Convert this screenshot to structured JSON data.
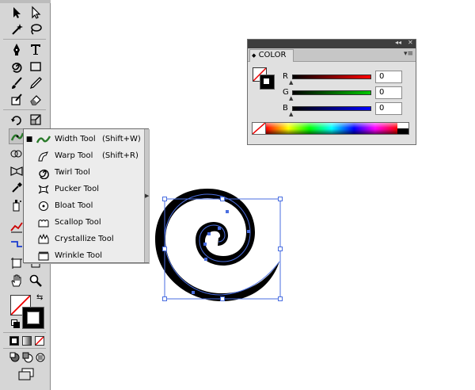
{
  "flyout": {
    "items": [
      {
        "label": "Width Tool",
        "shortcut": "(Shift+W)",
        "selected": true,
        "icon": "width-tool-icon"
      },
      {
        "label": "Warp Tool",
        "shortcut": "(Shift+R)",
        "selected": false,
        "icon": "warp-tool-icon"
      },
      {
        "label": "Twirl Tool",
        "shortcut": "",
        "selected": false,
        "icon": "twirl-tool-icon"
      },
      {
        "label": "Pucker Tool",
        "shortcut": "",
        "selected": false,
        "icon": "pucker-tool-icon"
      },
      {
        "label": "Bloat Tool",
        "shortcut": "",
        "selected": false,
        "icon": "bloat-tool-icon"
      },
      {
        "label": "Scallop Tool",
        "shortcut": "",
        "selected": false,
        "icon": "scallop-tool-icon"
      },
      {
        "label": "Crystallize Tool",
        "shortcut": "",
        "selected": false,
        "icon": "crystallize-tool-icon"
      },
      {
        "label": "Wrinkle Tool",
        "shortcut": "",
        "selected": false,
        "icon": "wrinkle-tool-icon"
      }
    ],
    "bullet": "■"
  },
  "color_panel": {
    "tab_label": "COLOR",
    "tab_arrows": "◆",
    "collapse_control": "◂◂",
    "close_control": "✕",
    "menu_control": "▾≡",
    "channels": [
      {
        "label": "R",
        "value": "0",
        "color": "#ff0000"
      },
      {
        "label": "G",
        "value": "0",
        "color": "#00c800"
      },
      {
        "label": "B",
        "value": "0",
        "color": "#0000ff"
      }
    ],
    "fill": "none",
    "stroke": "#000000"
  },
  "toolbox": {
    "fill": "none",
    "stroke": "#000000",
    "swap_glyph": "⇆",
    "selection_color": "#4a6ee0"
  },
  "artwork": {
    "shape": "spiral",
    "fill": "#000000",
    "selection_color": "#4a6ee0"
  }
}
